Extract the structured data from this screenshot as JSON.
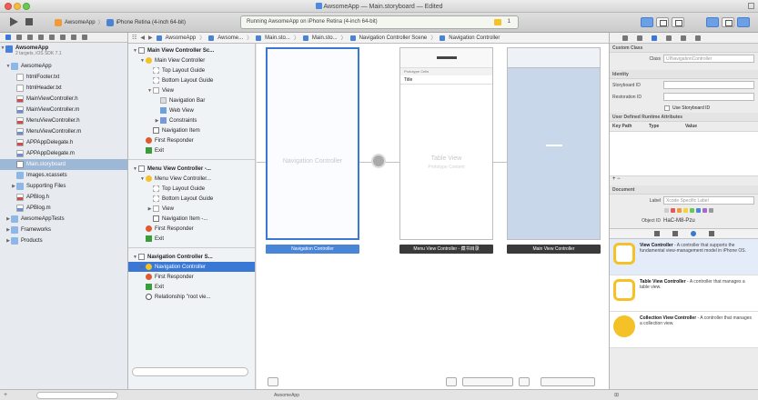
{
  "window": {
    "title": "AwsomeApp — Main.storyboard — Edited"
  },
  "toolbar": {
    "scheme_target": "AwsomeApp",
    "scheme_device": "iPhone Retina (4-inch 64-bit)",
    "activity_text": "Running AwsomeApp on iPhone Retina (4-inch 64-bit)",
    "warning_count": "1"
  },
  "navigator": {
    "project": "AwsomeApp",
    "project_sub": "2 targets, iOS SDK 7.1",
    "items": [
      {
        "label": "AwsomeApp",
        "indent": 1,
        "icon": "folder",
        "tri": "▼"
      },
      {
        "label": "htmlFooter.txt",
        "indent": 2,
        "icon": "file"
      },
      {
        "label": "htmlHeader.txt",
        "indent": 2,
        "icon": "file"
      },
      {
        "label": "MainViewController.h",
        "indent": 2,
        "icon": "h"
      },
      {
        "label": "MainViewController.m",
        "indent": 2,
        "icon": "m"
      },
      {
        "label": "MenuViewController.h",
        "indent": 2,
        "icon": "h"
      },
      {
        "label": "MenuViewController.m",
        "indent": 2,
        "icon": "m"
      },
      {
        "label": "APPAppDelegate.h",
        "indent": 2,
        "icon": "h"
      },
      {
        "label": "APPAppDelegate.m",
        "indent": 2,
        "icon": "m"
      },
      {
        "label": "Main.storyboard",
        "indent": 2,
        "icon": "sb",
        "selected": true
      },
      {
        "label": "Images.xcassets",
        "indent": 2,
        "icon": "folder"
      },
      {
        "label": "Supporting Files",
        "indent": 2,
        "icon": "folder",
        "tri": "▶"
      },
      {
        "label": "APBlog.h",
        "indent": 2,
        "icon": "h"
      },
      {
        "label": "APBlog.m",
        "indent": 2,
        "icon": "m"
      },
      {
        "label": "AwsomeAppTests",
        "indent": 1,
        "icon": "folder",
        "tri": "▶"
      },
      {
        "label": "Frameworks",
        "indent": 1,
        "icon": "folder",
        "tri": "▶"
      },
      {
        "label": "Products",
        "indent": 1,
        "icon": "folder",
        "tri": "▶"
      }
    ]
  },
  "jumpbar": {
    "crumbs": [
      "AwsomeApp",
      "Awsome...",
      "Main.sto...",
      "Main.sto...",
      "Navigation Controller Scene",
      "Navigation Controller"
    ]
  },
  "outline": {
    "rows": [
      {
        "label": "Main View Controller Sc...",
        "indent": 0,
        "icon": "scene",
        "tri": "▼",
        "bold": true
      },
      {
        "label": "Main View Controller",
        "indent": 1,
        "icon": "vc",
        "tri": "▼"
      },
      {
        "label": "Top Layout Guide",
        "indent": 2,
        "icon": "guide"
      },
      {
        "label": "Bottom Layout Guide",
        "indent": 2,
        "icon": "guide"
      },
      {
        "label": "View",
        "indent": 2,
        "icon": "view",
        "tri": "▼"
      },
      {
        "label": "Navigation Bar",
        "indent": 3,
        "icon": "navbar"
      },
      {
        "label": "Web View",
        "indent": 3,
        "icon": "web"
      },
      {
        "label": "Constraints",
        "indent": 3,
        "icon": "cons",
        "tri": "▶"
      },
      {
        "label": "Navigation Item",
        "indent": 2,
        "icon": "item"
      },
      {
        "label": "First Responder",
        "indent": 1,
        "icon": "resp"
      },
      {
        "label": "Exit",
        "indent": 1,
        "icon": "exit"
      },
      {
        "divider": true
      },
      {
        "label": "Menu View Controller -...",
        "indent": 0,
        "icon": "scene",
        "tri": "▼",
        "bold": true
      },
      {
        "label": "Menu View Controller...",
        "indent": 1,
        "icon": "vc",
        "tri": "▼"
      },
      {
        "label": "Top Layout Guide",
        "indent": 2,
        "icon": "guide"
      },
      {
        "label": "Bottom Layout Guide",
        "indent": 2,
        "icon": "guide"
      },
      {
        "label": "View",
        "indent": 2,
        "icon": "view",
        "tri": "▶"
      },
      {
        "label": "Navigation Item -...",
        "indent": 2,
        "icon": "item"
      },
      {
        "label": "First Responder",
        "indent": 1,
        "icon": "resp"
      },
      {
        "label": "Exit",
        "indent": 1,
        "icon": "exit"
      },
      {
        "divider": true
      },
      {
        "label": "Navigation Controller S...",
        "indent": 0,
        "icon": "scene",
        "tri": "▼",
        "bold": true
      },
      {
        "label": "Navigation Controller",
        "indent": 1,
        "icon": "vc",
        "tri": "▶",
        "selected": true
      },
      {
        "label": "First Responder",
        "indent": 1,
        "icon": "resp"
      },
      {
        "label": "Exit",
        "indent": 1,
        "icon": "exit"
      },
      {
        "label": "Relationship \"root vie...",
        "indent": 1,
        "icon": "rel"
      }
    ]
  },
  "canvas": {
    "nav_scene_label": "Navigation Controller",
    "menu_proto": "Prototype Cells",
    "menu_title_cell": "Title",
    "menu_tv_label": "Table View",
    "menu_tv_sub": "Prototype Content",
    "caption_nav": "Navigation Controller",
    "caption_menu": "Menu View Controller - 藏书目录",
    "caption_main": "Main View Controller"
  },
  "inspector": {
    "custom_class_hdr": "Custom Class",
    "class_label": "Class",
    "class_placeholder": "UINavigationController",
    "identity_hdr": "Identity",
    "storyboard_id_label": "Storyboard ID",
    "restoration_id_label": "Restoration ID",
    "use_storyboard_id": "Use Storyboard ID",
    "udra_hdr": "User Defined Runtime Attributes",
    "col_keypath": "Key Path",
    "col_type": "Type",
    "col_value": "Value",
    "plus_minus": "+ −",
    "document_hdr": "Document",
    "label_label": "Label",
    "label_placeholder": "Xcode Specific Label",
    "object_id_label": "Object ID",
    "object_id_value": "HaC-M8-Pzu"
  },
  "library": {
    "items": [
      {
        "title": "View Controller",
        "desc": " - A controller that supports the fundamental view-management model in iPhone OS.",
        "icon": "rounded",
        "selected": true
      },
      {
        "title": "Table View Controller",
        "desc": " - A controller that manages a table view.",
        "icon": "rounded"
      },
      {
        "title": "Collection View Controller",
        "desc": " - A controller that manages a collection view.",
        "icon": "solid"
      }
    ]
  },
  "debug": {
    "scheme_label": "AwsomeApp"
  },
  "colors": {
    "accent": "#3a78d6",
    "yellow": "#f4c227"
  }
}
